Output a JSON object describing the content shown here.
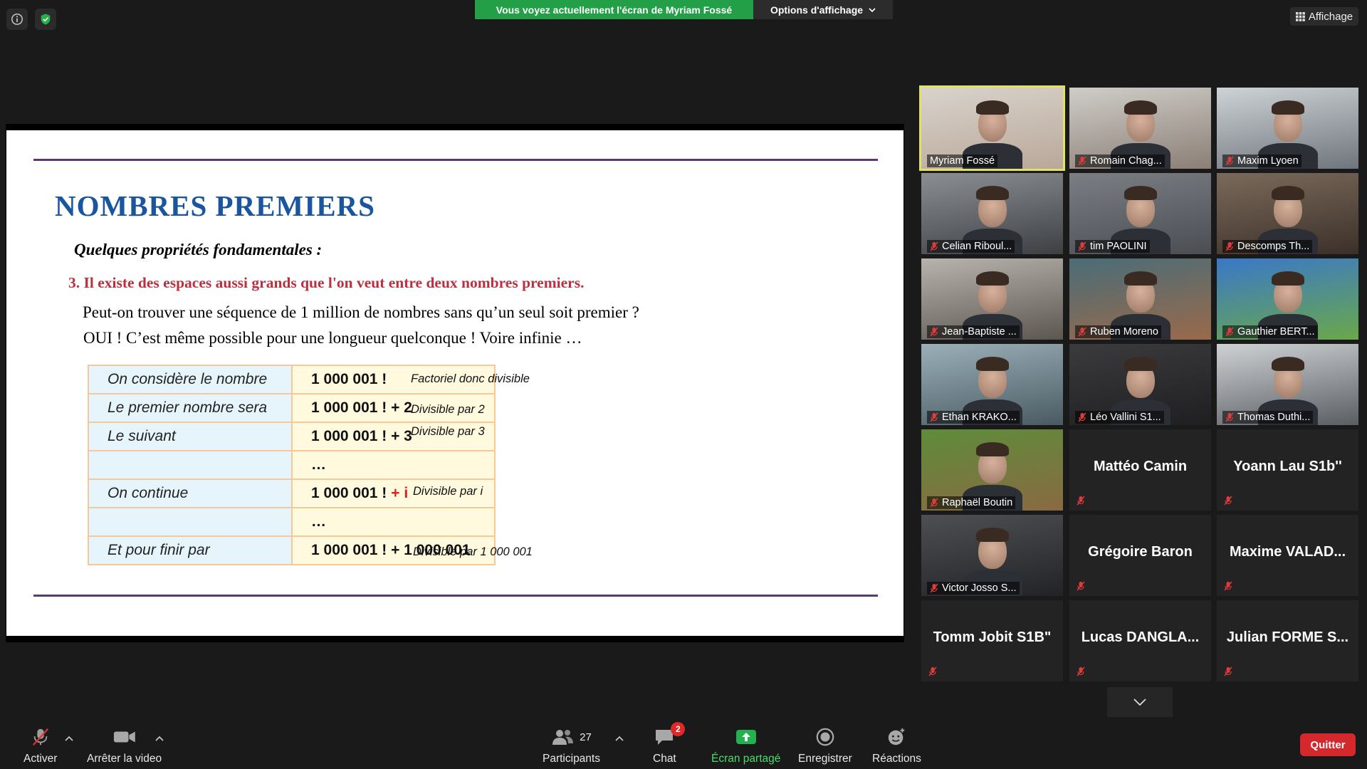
{
  "top": {
    "banner_text": "Vous voyez actuellement l'écran de Myriam Fossé",
    "view_options_label": "Options d'affichage",
    "layout_button_label": "Affichage"
  },
  "slide": {
    "title": "NOMBRES PREMIERS",
    "subtitle": "Quelques propriétés fondamentales :",
    "point": "3. Il existe des espaces aussi grands que l'on veut entre deux nombres premiers.",
    "question": "Peut-on trouver une séquence de 1 million de nombres sans qu’un seul soit premier ?",
    "answer": "OUI ! C’est même possible pour une longueur quelconque ! Voire infinie …",
    "rows": [
      {
        "label": "On considère le nombre",
        "value": "1 000 001 !",
        "extra": "",
        "note": "Factoriel donc divisible"
      },
      {
        "label": "Le premier nombre sera",
        "value": "1 000 001 ! + 2",
        "extra": "",
        "note": "Divisible  par 2"
      },
      {
        "label": "Le suivant",
        "value": "1 000 001 ! + 3",
        "extra": "",
        "note": "Divisible  par 3"
      },
      {
        "label": "",
        "value": "…",
        "extra": "",
        "note": ""
      },
      {
        "label": "On continue",
        "value": "1 000 001 !",
        "extra": "+ i",
        "note": "Divisible  par i"
      },
      {
        "label": "",
        "value": "…",
        "extra": "",
        "note": ""
      },
      {
        "label": "Et pour finir par",
        "value": "1 000 001 ! + 1 000 001",
        "extra": "",
        "note": "Divisible  par 1 000 001"
      }
    ]
  },
  "gallery": {
    "tiles": [
      {
        "name": "Myriam Fossé",
        "video": true,
        "muted": false,
        "active": true
      },
      {
        "name": "Romain Chag...",
        "video": true,
        "muted": true
      },
      {
        "name": "Maxim Lyoen",
        "video": true,
        "muted": true
      },
      {
        "name": "Celian Riboul...",
        "video": true,
        "muted": true
      },
      {
        "name": "tim PAOLINI",
        "video": true,
        "muted": true
      },
      {
        "name": "Descomps Th...",
        "video": true,
        "muted": true
      },
      {
        "name": "Jean-Baptiste ...",
        "video": true,
        "muted": true
      },
      {
        "name": "Ruben Moreno",
        "video": true,
        "muted": true
      },
      {
        "name": "Gauthier BERT...",
        "video": true,
        "muted": true
      },
      {
        "name": "Ethan KRAKO...",
        "video": true,
        "muted": true
      },
      {
        "name": "Léo Vallini S1...",
        "video": true,
        "muted": true
      },
      {
        "name": "Thomas Duthi...",
        "video": true,
        "muted": true
      },
      {
        "name": "Raphaël Boutin",
        "video": true,
        "muted": true
      },
      {
        "name": "Mattéo Camin",
        "video": false,
        "muted": true
      },
      {
        "name": "Yoann Lau S1b''",
        "video": false,
        "muted": true
      },
      {
        "name": "Victor Josso S...",
        "video": true,
        "muted": true
      },
      {
        "name": "Grégoire Baron",
        "video": false,
        "muted": true
      },
      {
        "name": "Maxime  VALAD...",
        "video": false,
        "muted": true
      },
      {
        "name": "Tomm Jobit S1B\"",
        "video": false,
        "muted": true
      },
      {
        "name": "Lucas  DANGLA...",
        "video": false,
        "muted": true
      },
      {
        "name": "Julian  FORME  S...",
        "video": false,
        "muted": true
      }
    ]
  },
  "toolbar": {
    "unmute_label": "Activer",
    "stop_video_label": "Arrêter la video",
    "participants_label": "Participants",
    "participants_count": "27",
    "chat_label": "Chat",
    "chat_badge": "2",
    "share_label": "Écran partagé",
    "record_label": "Enregistrer",
    "reactions_label": "Réactions",
    "quit_label": "Quitter"
  },
  "colors": {
    "banner": "#23a047",
    "active_speaker_outline": "#dfe16a",
    "quit": "#d5282d",
    "slide_title": "#1a56a0",
    "slide_point": "#b8323e"
  }
}
